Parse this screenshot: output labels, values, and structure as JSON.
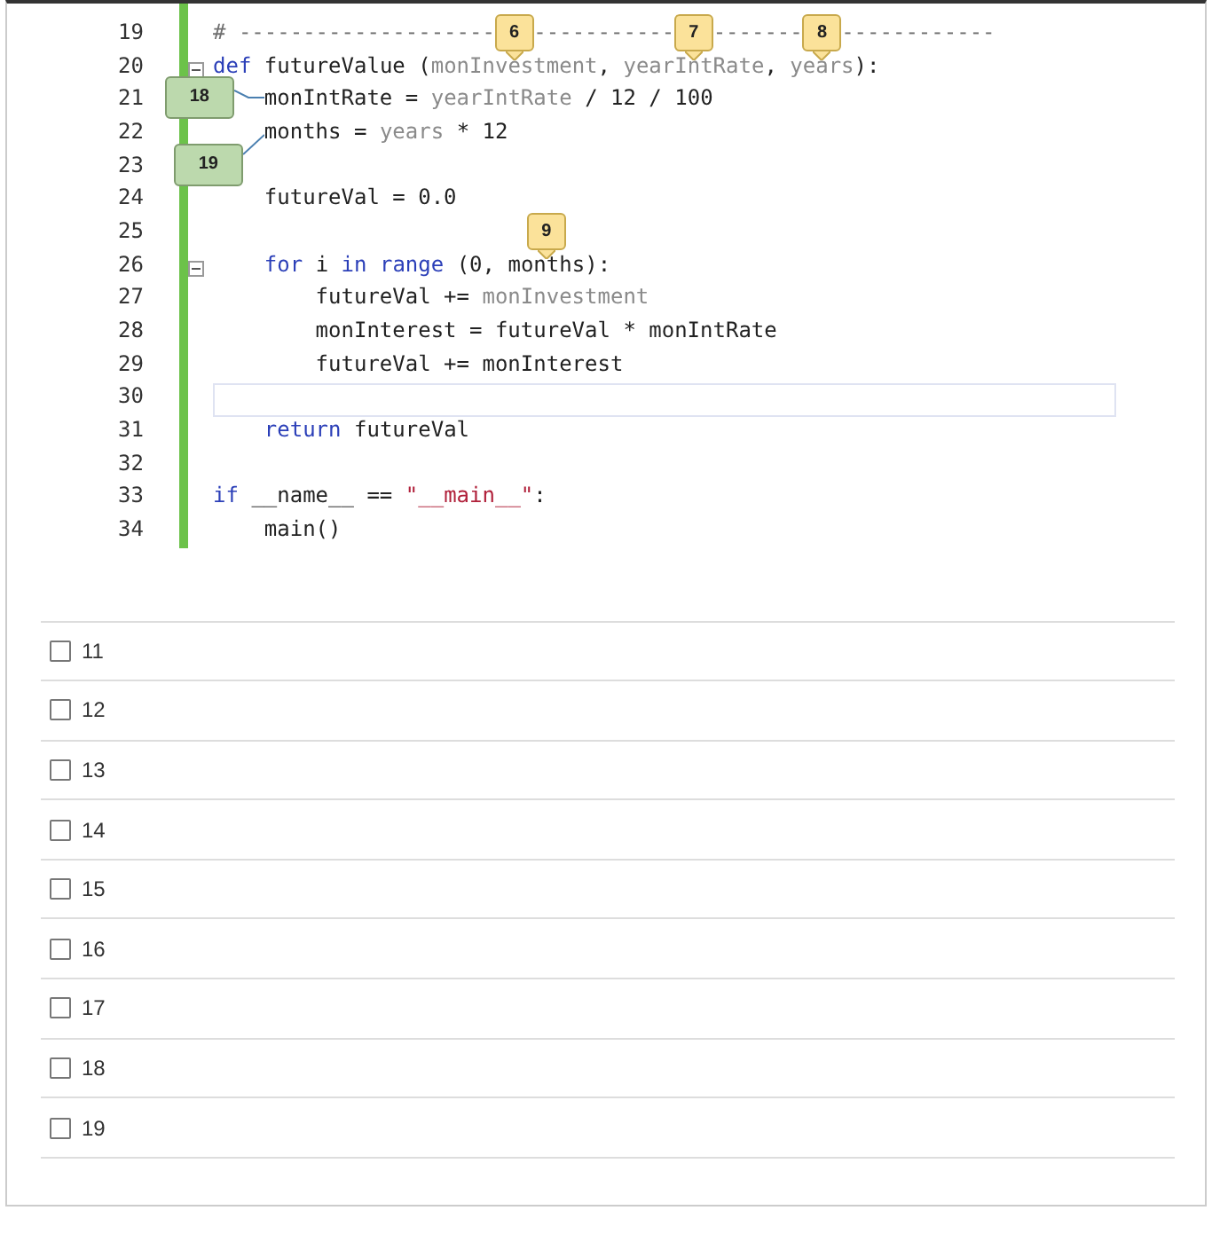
{
  "code": {
    "lines": [
      {
        "number": "19",
        "tokens": [
          {
            "kind": "comment",
            "text": "# --------------------"
          },
          {
            "kind": "comment",
            "text": "   -----------"
          },
          {
            "kind": "comment",
            "text": "   -------"
          },
          {
            "kind": "comment",
            "text": "   ------------"
          }
        ]
      },
      {
        "number": "20",
        "collapsible": true,
        "tokens": [
          {
            "kind": "kw",
            "text": "def"
          },
          {
            "kind": "plain",
            "text": " futureValue ("
          },
          {
            "kind": "param",
            "text": "monInvestment",
            "callout": {
              "kind": "above",
              "label": "6"
            }
          },
          {
            "kind": "plain",
            "text": ", "
          },
          {
            "kind": "param",
            "text": "yearIntRate",
            "callout": {
              "kind": "above",
              "label": "7"
            }
          },
          {
            "kind": "plain",
            "text": ", "
          },
          {
            "kind": "param",
            "text": "years",
            "callout": {
              "kind": "above",
              "label": "8"
            }
          },
          {
            "kind": "plain",
            "text": "):"
          }
        ]
      },
      {
        "number": "21",
        "tokens": [
          {
            "kind": "plain",
            "text": "    monIntRate",
            "callout": {
              "kind": "left",
              "label": "18"
            }
          },
          {
            "kind": "plain",
            "text": " = "
          },
          {
            "kind": "param",
            "text": "yearIntRate"
          },
          {
            "kind": "plain",
            "text": " / 12 / 100"
          }
        ]
      },
      {
        "number": "22",
        "tokens": [
          {
            "kind": "plain",
            "text": "    months",
            "callout": {
              "kind": "below_left",
              "label": "19"
            }
          },
          {
            "kind": "plain",
            "text": " = "
          },
          {
            "kind": "param",
            "text": "years"
          },
          {
            "kind": "plain",
            "text": " * 12"
          }
        ]
      },
      {
        "number": "23"
      },
      {
        "number": "24",
        "tokens": [
          {
            "kind": "plain",
            "text": "    futureVal = 0.0"
          }
        ]
      },
      {
        "number": "25"
      },
      {
        "number": "26",
        "collapsible": true,
        "tokens": [
          {
            "kind": "kw",
            "text": "    for"
          },
          {
            "kind": "plain",
            "text": " i "
          },
          {
            "kind": "kw",
            "text": "in"
          },
          {
            "kind": "kw",
            "text": " range"
          },
          {
            "kind": "plain",
            "text": " (0, "
          },
          {
            "kind": "plain",
            "text": "months",
            "callout": {
              "kind": "above",
              "label": "9"
            }
          },
          {
            "kind": "plain",
            "text": "):"
          }
        ]
      },
      {
        "number": "27",
        "tokens": [
          {
            "kind": "plain",
            "text": "        futureVal += "
          },
          {
            "kind": "param",
            "text": "monInvestment"
          }
        ]
      },
      {
        "number": "28",
        "tokens": [
          {
            "kind": "plain",
            "text": "        monInterest = futureVal * monIntRate"
          }
        ]
      },
      {
        "number": "29",
        "tokens": [
          {
            "kind": "plain",
            "text": "        futureVal += monInterest"
          }
        ]
      },
      {
        "number": "30",
        "current": true
      },
      {
        "number": "31",
        "tokens": [
          {
            "kind": "kw",
            "text": "    return"
          },
          {
            "kind": "plain",
            "text": " futureVal"
          }
        ]
      },
      {
        "number": "32"
      },
      {
        "number": "33",
        "tokens": [
          {
            "kind": "kw",
            "text": "if"
          },
          {
            "kind": "plain",
            "text": " __name__ == "
          },
          {
            "kind": "str",
            "text": "\"__main__\""
          },
          {
            "kind": "plain",
            "text": ":"
          }
        ]
      },
      {
        "number": "34",
        "tokens": [
          {
            "kind": "plain",
            "text": "    main()"
          }
        ]
      }
    ]
  },
  "options": [
    {
      "label": "11",
      "checked": false
    },
    {
      "label": "12",
      "checked": false
    },
    {
      "label": "13",
      "checked": false
    },
    {
      "label": "14",
      "checked": false
    },
    {
      "label": "15",
      "checked": false
    },
    {
      "label": "16",
      "checked": false
    },
    {
      "label": "17",
      "checked": false
    },
    {
      "label": "18",
      "checked": false
    },
    {
      "label": "19",
      "checked": false
    }
  ]
}
